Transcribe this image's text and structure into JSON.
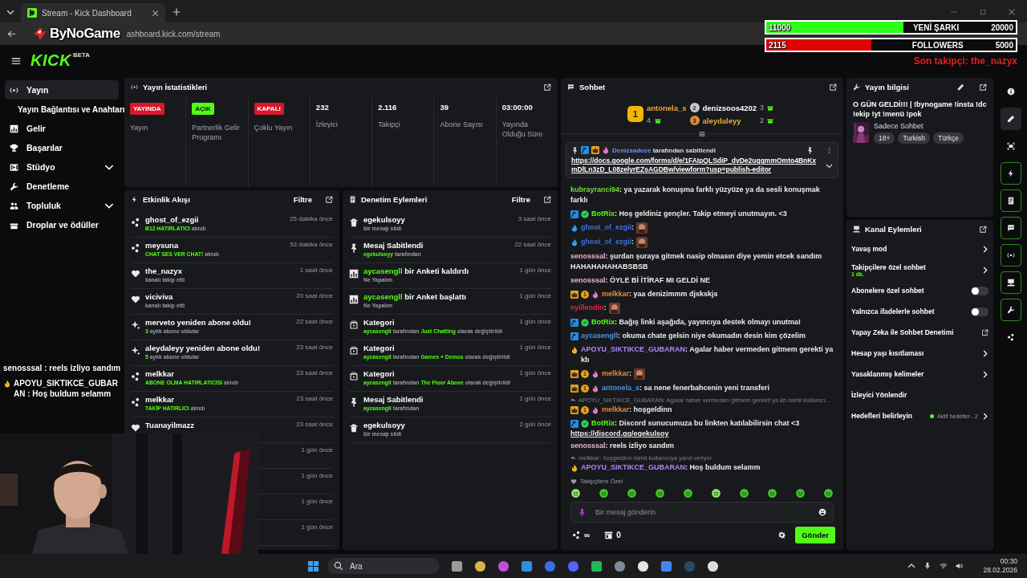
{
  "browser": {
    "tab_title": "Stream - Kick Dashboard",
    "url": "ashboard.kick.com/stream"
  },
  "overlay_logo": "ByNoGame",
  "goals": [
    {
      "start": "11000",
      "label": "YENİ ŞARKI",
      "end": "20000",
      "level": 0.55,
      "color": "#2bff1a"
    },
    {
      "start": "2115",
      "label": "FOLLOWERS",
      "end": "5000",
      "level": 0.42,
      "color": "#e00000"
    }
  ],
  "last_follower": "Son takipçi: the_nazyx",
  "header": {
    "logo": "KICK",
    "logo_tag": "BETA"
  },
  "sidebar": [
    {
      "kind": "link",
      "label": "Yayın",
      "selected": true
    },
    {
      "kind": "sub",
      "label": "Yayın Bağlantısı ve Anahtarı",
      "selected": false
    },
    {
      "kind": "link",
      "label": "Gelir",
      "selected": false
    },
    {
      "kind": "link",
      "label": "Başarılar",
      "selected": false
    },
    {
      "kind": "group",
      "label": "Stüdyo",
      "selected": false,
      "expanded": false
    },
    {
      "kind": "link",
      "label": "Denetleme",
      "selected": false
    },
    {
      "kind": "group",
      "label": "Topluluk",
      "selected": false,
      "expanded": false
    },
    {
      "kind": "link",
      "label": "Droplar ve ödüller",
      "selected": false
    }
  ],
  "stats": {
    "title": "Yayın İstatistikleri",
    "items": [
      {
        "kind": "badge",
        "value": "YAYINDA",
        "color": "#d8182b",
        "label": "Yayın"
      },
      {
        "kind": "badge",
        "value": "AÇIK",
        "color": "#53fc18",
        "label": "Partnerlik Gelir Programı"
      },
      {
        "kind": "badge",
        "value": "KAPALI",
        "color": "#d8182b",
        "label": "Çoklu Yayın"
      },
      {
        "kind": "number",
        "value": "232",
        "label": "İzleyici"
      },
      {
        "kind": "number",
        "value": "2.116",
        "label": "Takipçi"
      },
      {
        "kind": "number",
        "value": "39",
        "label": "Abone Sayısı"
      },
      {
        "kind": "number",
        "value": "03:00:00",
        "label": "Yayında Olduğu Süre"
      }
    ]
  },
  "activity": {
    "title": "Etkinlik Akışı",
    "filter": "Filtre",
    "items": [
      {
        "kind": "reward",
        "title": "ghost_of_ezgii",
        "detail": [
          {
            "text": "B12 HATIRLATICI",
            "accent": true
          },
          {
            "text": "alındı",
            "accent": false
          }
        ],
        "time": "25 dakika önce"
      },
      {
        "kind": "reward",
        "title": "meysuna",
        "detail": [
          {
            "text": "CHAT SES VER CHAT!",
            "accent": true
          },
          {
            "text": "alındı",
            "accent": false
          }
        ],
        "time": "53 dakika önce"
      },
      {
        "kind": "follow",
        "title": "the_nazyx",
        "detail": [
          {
            "text": "kanalı takip etti",
            "accent": false
          }
        ],
        "time": "1 saat önce"
      },
      {
        "kind": "follow",
        "title": "viciviva",
        "detail": [
          {
            "text": "kanalı takip etti",
            "accent": false
          }
        ],
        "time": "20 saat önce"
      },
      {
        "kind": "resub",
        "title": "merveto yeniden abone oldu!",
        "detail": [
          {
            "text": "3",
            "accent": true
          },
          {
            "text": "aylık abone oldular",
            "accent": false
          }
        ],
        "time": "22 saat önce"
      },
      {
        "kind": "resub",
        "title": "aleydaleyy yeniden abone oldu!",
        "detail": [
          {
            "text": "5",
            "accent": true
          },
          {
            "text": "aylık abone oldular",
            "accent": false
          }
        ],
        "time": "23 saat önce"
      },
      {
        "kind": "reward",
        "title": "melkkar",
        "detail": [
          {
            "text": "ABONE OLMA HATIRLATICISI",
            "accent": true
          },
          {
            "text": "alındı",
            "accent": false
          }
        ],
        "time": "23 saat önce"
      },
      {
        "kind": "reward",
        "title": "melkkar",
        "detail": [
          {
            "text": "TAKİP HATIRLICI",
            "accent": true
          },
          {
            "text": "alındı",
            "accent": false
          }
        ],
        "time": "23 saat önce"
      },
      {
        "kind": "follow",
        "title": "Tuanayilmazz",
        "time": "23 saat önce"
      },
      {
        "time": "1 gün önce"
      },
      {
        "time": "1 gün önce"
      },
      {
        "time": "1 gün önce"
      },
      {
        "time": "1 gün önce"
      }
    ]
  },
  "moderation": {
    "title": "Denetim Eylemleri",
    "filter": "Filtre",
    "items": [
      {
        "kind": "delete",
        "title": [
          {
            "text": "egekulsoyy",
            "accent": false
          }
        ],
        "detail": [
          {
            "text": "bir mesajı sildi",
            "accent": false
          }
        ],
        "time": "3 saat önce"
      },
      {
        "kind": "pin",
        "title": [
          {
            "text": "Mesaj Sabitlendi",
            "accent": false
          }
        ],
        "detail": [
          {
            "text": "egekulsoyy",
            "accent": true
          },
          {
            "text": "tarafından",
            "accent": false
          }
        ],
        "time": "22 saat önce"
      },
      {
        "kind": "poll",
        "title": [
          {
            "text": "aycasengll",
            "accent": true
          },
          {
            "text": "bir Anketi kaldırdı",
            "accent": false
          }
        ],
        "detail": [
          {
            "text": "Ne Yapalım",
            "accent": false
          }
        ],
        "time": "1 gün önce"
      },
      {
        "kind": "poll",
        "title": [
          {
            "text": "aycasengll",
            "accent": true
          },
          {
            "text": "bir Anket başlattı",
            "accent": false
          }
        ],
        "detail": [
          {
            "text": "Ne Yapalım",
            "accent": false
          }
        ],
        "time": "1 gün önce"
      },
      {
        "kind": "category",
        "title": [
          {
            "text": "Kategori",
            "accent": false
          }
        ],
        "detail": [
          {
            "text": "aycasengll",
            "accent": true
          },
          {
            "text": "tarafından",
            "accent": false
          },
          {
            "text": "Just Chatting",
            "accent": true
          },
          {
            "text": "olarak değiştirildi",
            "accent": false
          }
        ],
        "time": "1 gün önce"
      },
      {
        "kind": "category",
        "title": [
          {
            "text": "Kategori",
            "accent": false
          }
        ],
        "detail": [
          {
            "text": "aycasengll",
            "accent": true
          },
          {
            "text": "tarafından",
            "accent": false
          },
          {
            "text": "Games + Demos",
            "accent": true
          },
          {
            "text": "olarak değiştirildi",
            "accent": false
          }
        ],
        "time": "1 gün önce"
      },
      {
        "kind": "category",
        "title": [
          {
            "text": "Kategori",
            "accent": false
          }
        ],
        "detail": [
          {
            "text": "aycasengll",
            "accent": true
          },
          {
            "text": "tarafından",
            "accent": false
          },
          {
            "text": "The Floor Above",
            "accent": true
          },
          {
            "text": "olarak değiştirildi",
            "accent": false
          }
        ],
        "time": "1 gün önce"
      },
      {
        "kind": "pin",
        "title": [
          {
            "text": "Mesaj Sabitlendi",
            "accent": false
          }
        ],
        "detail": [
          {
            "text": "aycasengll",
            "accent": true
          },
          {
            "text": "tarafından",
            "accent": false
          }
        ],
        "time": "1 gün önce"
      },
      {
        "kind": "delete",
        "title": [
          {
            "text": "egekulsoyy",
            "accent": false
          }
        ],
        "detail": [
          {
            "text": "bir mesajı sildi",
            "accent": false
          }
        ],
        "time": "2 gün önce"
      }
    ]
  },
  "chat": {
    "title": "Sohbet",
    "leaders": [
      {
        "rank": "1",
        "user": "antonela_s",
        "color": "#e8a93c",
        "count": "4"
      },
      {
        "rank": "2",
        "user": "denizsoos4202",
        "color": "#ffffff",
        "count": "3"
      },
      {
        "rank": "3",
        "user": "aleydaleyy",
        "color": "#e8a93c",
        "count": "2"
      }
    ],
    "pinned": {
      "badges": [
        {
          "kind": "mod"
        },
        {
          "kind": "sub"
        },
        {
          "kind": "flame",
          "color": "#e879c6"
        }
      ],
      "by": "Denizsadece",
      "text": "tarafından sabitlendi",
      "link": "https://docs.google.com/forms/d/e/1FAIpQLSdiP_dvDe2uggmmOmto4BnKxmDlLn3zD_L08zelyrEZsAGDBw/viewform?usp=publish-editor"
    },
    "messages": [
      {
        "kind": "text",
        "user": "kubrayranci94",
        "color": "#6bde3a",
        "text": ": ya yazarak konuşma farklı yüzyüze ya da sesli konuşmak farklı"
      },
      {
        "kind": "text",
        "badges": [
          {
            "kind": "mod"
          },
          {
            "kind": "verified"
          }
        ],
        "user": "BotRix",
        "color": "#53fc18",
        "text": ": Hoş geldiniz gençler. Takip etmeyi unutmayın. <3"
      },
      {
        "kind": "emote",
        "badges": [
          {
            "kind": "flame",
            "color": "#3aa0e8"
          }
        ],
        "user": "ghost_of_ezgii",
        "color": "#3e6fe0",
        "text": ":"
      },
      {
        "kind": "emote",
        "badges": [
          {
            "kind": "flame",
            "color": "#3aa0e8"
          }
        ],
        "user": "ghost_of_ezgii",
        "color": "#3e6fe0",
        "text": ":"
      },
      {
        "kind": "text",
        "user": "senosssal",
        "color": "#e8b4c8",
        "text": ": şurdan şuraya gitmek nasip olmasın diye yemin etcek sandım HAHAHAHAHABSBSB"
      },
      {
        "kind": "text",
        "user": "senosssal",
        "color": "#e8b4c8",
        "text": ": ÖYLE Bİ İTİRAF MI GELDİ NE"
      },
      {
        "kind": "text",
        "badges": [
          {
            "kind": "sub"
          },
          {
            "kind": "gift",
            "text": "1"
          },
          {
            "kind": "flame",
            "color": "#e879c6"
          }
        ],
        "user": "melkkar",
        "color": "#e8893a",
        "text": ": yaa denizimmm djskskjs"
      },
      {
        "kind": "emote",
        "user": "eyillendin",
        "color": "#e0253c",
        "text": ":"
      },
      {
        "kind": "text",
        "badges": [
          {
            "kind": "mod"
          },
          {
            "kind": "verified"
          }
        ],
        "user": "BotRix",
        "color": "#53fc18",
        "text": ": Bağış linki aşağıda, yayıncıya destek olmayı unutma!"
      },
      {
        "kind": "text",
        "badges": [
          {
            "kind": "mod"
          }
        ],
        "user": "aycasengll",
        "color": "#4f8fe8",
        "text": ": okuma chate gelsin niye okumadın desin kim çözelim"
      },
      {
        "kind": "text",
        "badges": [
          {
            "kind": "flame",
            "color": "#f0b429"
          }
        ],
        "user": "APOYU_SIKTIKCE_GUBARAN",
        "color": "#b182ff",
        "text": ": Agalar haber vermeden gitmem gerekti ya kb"
      },
      {
        "kind": "emote",
        "badges": [
          {
            "kind": "sub"
          },
          {
            "kind": "gift",
            "text": "1"
          },
          {
            "kind": "flame",
            "color": "#e879c6"
          }
        ],
        "user": "melkkar",
        "color": "#e8893a",
        "text": ":"
      },
      {
        "kind": "text",
        "badges": [
          {
            "kind": "sub"
          },
          {
            "kind": "gift",
            "text": "1"
          },
          {
            "kind": "flame",
            "color": "#e879c6"
          }
        ],
        "user": "antonela_s",
        "color": "#4f8fe8",
        "text": ": sa nene fenerbahcenin yeni transferi"
      },
      {
        "kind": "text",
        "reply": "APOYU_SIKTIKCE_GUBARAN: Agalar haber vermeden gitmem gerekti ya kb isimli kullanıcı...",
        "badges": [
          {
            "kind": "sub"
          },
          {
            "kind": "gift",
            "text": "1"
          },
          {
            "kind": "flame",
            "color": "#e879c6"
          }
        ],
        "user": "melkkar",
        "color": "#e8893a",
        "text": ": hoşgeldinn"
      },
      {
        "kind": "text",
        "badges": [
          {
            "kind": "mod"
          },
          {
            "kind": "verified"
          }
        ],
        "user": "BotRix",
        "color": "#53fc18",
        "text": ": Discord sunucumuza bu linkten katılabilirsin chat <3",
        "link": "https://discord.gg/egekulsoy"
      },
      {
        "kind": "text",
        "user": "senosssal",
        "color": "#e8b4c8",
        "text": ": reels izliyo sandım"
      },
      {
        "kind": "text",
        "reply": "melkkar: hoşgeldinn isimli kullanıcıya yanıt veriyor",
        "badges": [
          {
            "kind": "flame",
            "color": "#f0b429"
          }
        ],
        "user": "APOYU_SIKTIKCE_GUBARAN",
        "color": "#b182ff",
        "text": ": Hoş buldum selamm"
      }
    ],
    "follower_only": "Takipçilere Özel",
    "placeholder": "Bir mesaj gönderin",
    "points": "∞",
    "store_count": "0",
    "send": "Gönder"
  },
  "info": {
    "title": "Yayın bilgisi",
    "stream_title": "O GÜN GELDİ!!! | !bynogame !insta !dc !ekip !yt !menü !pok",
    "category": "Sadece Sohbet",
    "tags": [
      "18+",
      "Turkish",
      "Türkçe"
    ]
  },
  "channel": {
    "title": "Kanal Eylemleri",
    "items": [
      {
        "kind": "menu",
        "label": "Yavaş mod"
      },
      {
        "kind": "menu",
        "label": "Takipçilere özel sohbet",
        "value": "1 dk."
      },
      {
        "kind": "toggle",
        "label": "Abonelere özel sohbet",
        "on": false
      },
      {
        "kind": "toggle",
        "label": "Yalnızca ifadelerle sohbet",
        "on": false
      },
      {
        "kind": "external",
        "label": "Yapay Zeka ile Sohbet Denetimi"
      },
      {
        "kind": "menu",
        "label": "Hesap yaşı kısıtlaması"
      },
      {
        "kind": "menu",
        "label": "Yasaklanmış kelimeler"
      },
      {
        "kind": "plain",
        "label": "İzleyici Yönlendir"
      },
      {
        "kind": "menu",
        "label": "Hedefleri belirleyin",
        "status": "Aktif hedefler - 2"
      }
    ]
  },
  "rail": [
    {
      "active": false,
      "selected": false
    },
    {
      "active": false,
      "selected": true
    },
    {
      "active": false,
      "selected": false
    },
    {
      "active": true,
      "selected": false
    },
    {
      "active": true,
      "selected": false
    },
    {
      "active": true,
      "selected": false
    },
    {
      "active": true,
      "selected": false
    },
    {
      "active": true,
      "selected": false
    },
    {
      "active": true,
      "selected": false
    },
    {
      "active": false,
      "selected": false
    }
  ],
  "stream_chat": [
    {
      "user": "senosssal",
      "text": " : reels izliyo sandım",
      "flame": false
    },
    {
      "user": "APOYU_SIKTIKCE_GUBARAN",
      "text": " : Hoş buldum selamm",
      "flame": true
    }
  ],
  "taskbar": {
    "search": "Ara",
    "time": "00:30",
    "date": "28.02.2026"
  }
}
